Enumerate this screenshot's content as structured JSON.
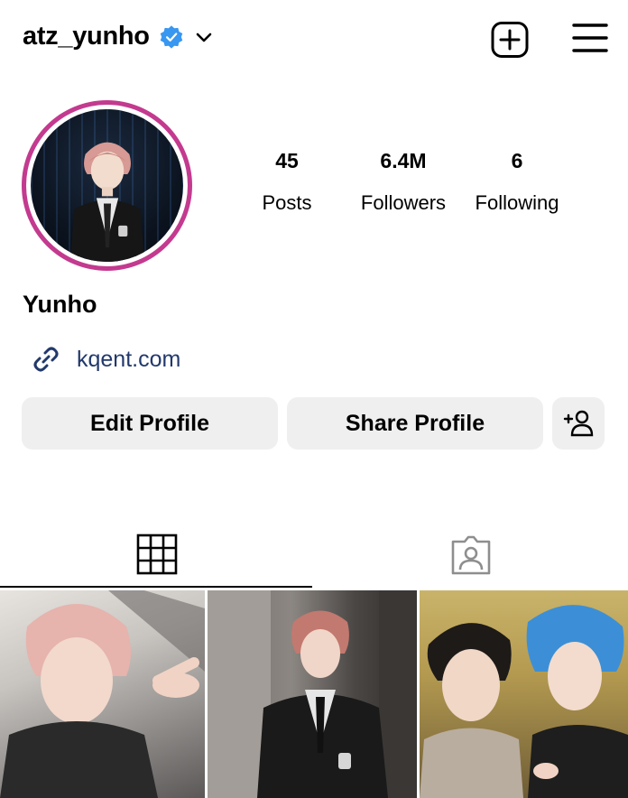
{
  "header": {
    "username": "atz_yunho",
    "icons": {
      "verified": "verified-badge-icon",
      "dropdown": "chevron-down-icon",
      "new_post": "plus-square-icon",
      "menu": "hamburger-menu-icon"
    },
    "accent": "#3897f0"
  },
  "profile": {
    "ring_color": "#c33a8f",
    "display_name": "Yunho",
    "link": "kqent.com",
    "link_color": "#22396b"
  },
  "stats": [
    {
      "value": "45",
      "label": "Posts"
    },
    {
      "value": "6.4M",
      "label": "Followers"
    },
    {
      "value": "6",
      "label": "Following"
    }
  ],
  "buttons": {
    "edit": "Edit Profile",
    "share": "Share Profile",
    "add_icon": "add-person-icon"
  },
  "tabs": [
    {
      "name": "grid",
      "icon": "grid-icon",
      "active": true
    },
    {
      "name": "tagged",
      "icon": "tagged-person-icon",
      "active": false
    }
  ]
}
